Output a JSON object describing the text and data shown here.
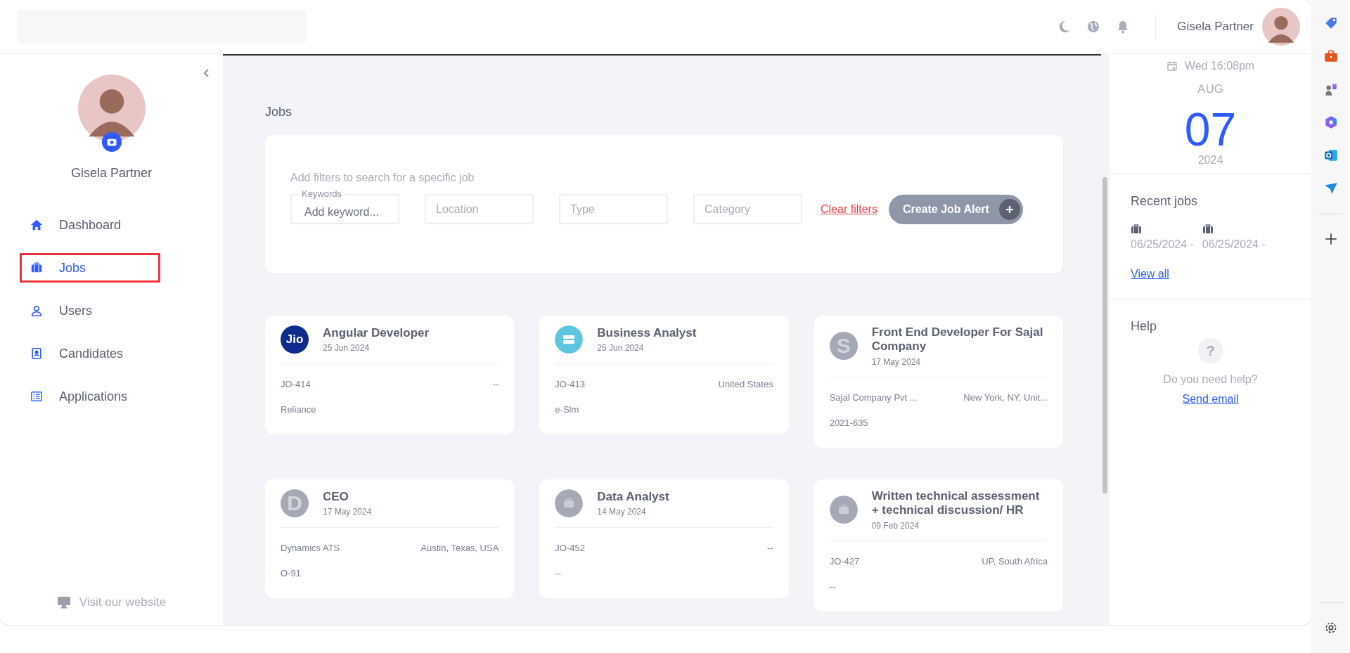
{
  "top_bar": {
    "user_name": "Gisela Partner"
  },
  "sidebar": {
    "user_name": "Gisela Partner",
    "items": [
      {
        "label": "Dashboard",
        "kind": "home",
        "selected": false
      },
      {
        "label": "Jobs",
        "kind": "briefcase",
        "selected": true
      },
      {
        "label": "Users",
        "kind": "user",
        "selected": false
      },
      {
        "label": "Candidates",
        "kind": "contact",
        "selected": false
      },
      {
        "label": "Applications",
        "kind": "list",
        "selected": false
      }
    ],
    "footer_link": "Visit our website"
  },
  "page_title": "Jobs",
  "filters": {
    "hint": "Add filters to search for a specific job",
    "fields": [
      {
        "label": "Keywords",
        "placeholder": "Add keyword..."
      },
      {
        "placeholder": "Location"
      },
      {
        "placeholder": "Type"
      },
      {
        "placeholder": "Category"
      }
    ],
    "clear_link": "Clear filters",
    "alert_button": "Create Job Alert"
  },
  "jobs": [
    {
      "title": "Angular Developer",
      "date": "25 Jun 2024",
      "logo": {
        "kind": "brand",
        "text": "Jio"
      },
      "rows": [
        {
          "left": "JO-414",
          "right": "--"
        },
        {
          "left": "Reliance"
        }
      ]
    },
    {
      "title": "Business Analyst",
      "date": "25 Jun 2024",
      "logo": {
        "kind": "glyph"
      },
      "rows": [
        {
          "left": "JO-413",
          "right": "United States"
        },
        {
          "left": "e-Slm"
        }
      ]
    },
    {
      "title": "Front End Developer For Sajal Company",
      "date": "17 May 2024",
      "logo": {
        "kind": "initial",
        "text": "S"
      },
      "rows": [
        {
          "left": "Sajal Company Pvt ...",
          "right": "New York, NY, Unit..."
        },
        {
          "left": "2021-635"
        }
      ]
    },
    {
      "title": "CEO",
      "date": "17 May 2024",
      "logo": {
        "kind": "initial",
        "text": "D"
      },
      "rows": [
        {
          "left": "Dynamics ATS",
          "right": "Austin, Texas, USA"
        },
        {
          "left": "O-91"
        }
      ]
    },
    {
      "title": "Data Analyst",
      "date": "14 May 2024",
      "logo": {
        "kind": "briefcase"
      },
      "rows": [
        {
          "left": "JO-452",
          "right": "--"
        },
        {
          "left": "--"
        }
      ]
    },
    {
      "title": "Written technical assessment + technical discussion/ HR",
      "date": "09 Feb 2024",
      "logo": {
        "kind": "briefcase"
      },
      "rows": [
        {
          "left": "JO-427",
          "right": "UP, South Africa"
        },
        {
          "left": "--"
        }
      ]
    }
  ],
  "right_panel": {
    "clock": "Wed 16:08pm",
    "month": "AUG",
    "day": "07",
    "year": "2024",
    "recent_jobs": {
      "title": "Recent jobs",
      "items": [
        "06/25/2024 -",
        "06/25/2024 -"
      ],
      "view_all": "View all"
    },
    "help": {
      "title": "Help",
      "icon": "?",
      "text": "Do you need help?",
      "link": "Send email"
    }
  }
}
